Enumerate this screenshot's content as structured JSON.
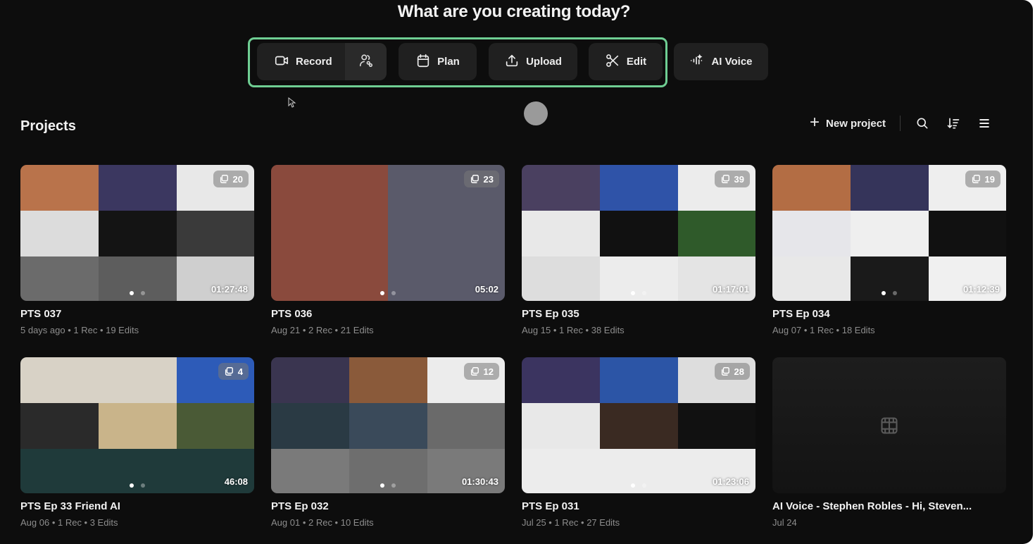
{
  "header": {
    "headline": "What are you creating today?"
  },
  "actions": [
    {
      "id": "record",
      "label": "Record",
      "icon": "video-camera-icon",
      "secondary_icon": "people-link-icon"
    },
    {
      "id": "plan",
      "label": "Plan",
      "icon": "calendar-icon"
    },
    {
      "id": "upload",
      "label": "Upload",
      "icon": "upload-icon"
    },
    {
      "id": "edit",
      "label": "Edit",
      "icon": "scissors-icon"
    },
    {
      "id": "aivoice",
      "label": "AI Voice",
      "icon": "ai-waveform-icon"
    }
  ],
  "highlight_color": "#6fce93",
  "projects": {
    "title": "Projects",
    "new_project_label": "New project",
    "toolbar_icons": [
      "plus-icon",
      "search-icon",
      "sort-icon",
      "list-view-icon"
    ],
    "items": [
      {
        "title": "PTS 037",
        "meta": "5 days ago • 1 Rec • 19 Edits",
        "clip_count": "20",
        "duration": "01:27:48"
      },
      {
        "title": "PTS 036",
        "meta": "Aug 21 • 2 Rec • 21 Edits",
        "clip_count": "23",
        "duration": "05:02"
      },
      {
        "title": "PTS Ep 035",
        "meta": "Aug 15 • 1 Rec • 38 Edits",
        "clip_count": "39",
        "duration": "01:17:01"
      },
      {
        "title": "PTS Ep 034",
        "meta": "Aug 07 • 1 Rec • 18 Edits",
        "clip_count": "19",
        "duration": "01:12:39"
      },
      {
        "title": "PTS Ep 33 Friend AI",
        "meta": "Aug 06 • 1 Rec • 3 Edits",
        "clip_count": "4",
        "duration": "46:08"
      },
      {
        "title": "PTS Ep 032",
        "meta": "Aug 01 • 2 Rec • 10 Edits",
        "clip_count": "12",
        "duration": "01:30:43"
      },
      {
        "title": "PTS Ep 031",
        "meta": "Jul 25 • 1 Rec • 27 Edits",
        "clip_count": "28",
        "duration": "01:23:06"
      },
      {
        "title": "AI Voice - Stephen Robles - Hi, Steven...",
        "meta": "Jul 24",
        "clip_count": null,
        "duration": null
      }
    ]
  }
}
